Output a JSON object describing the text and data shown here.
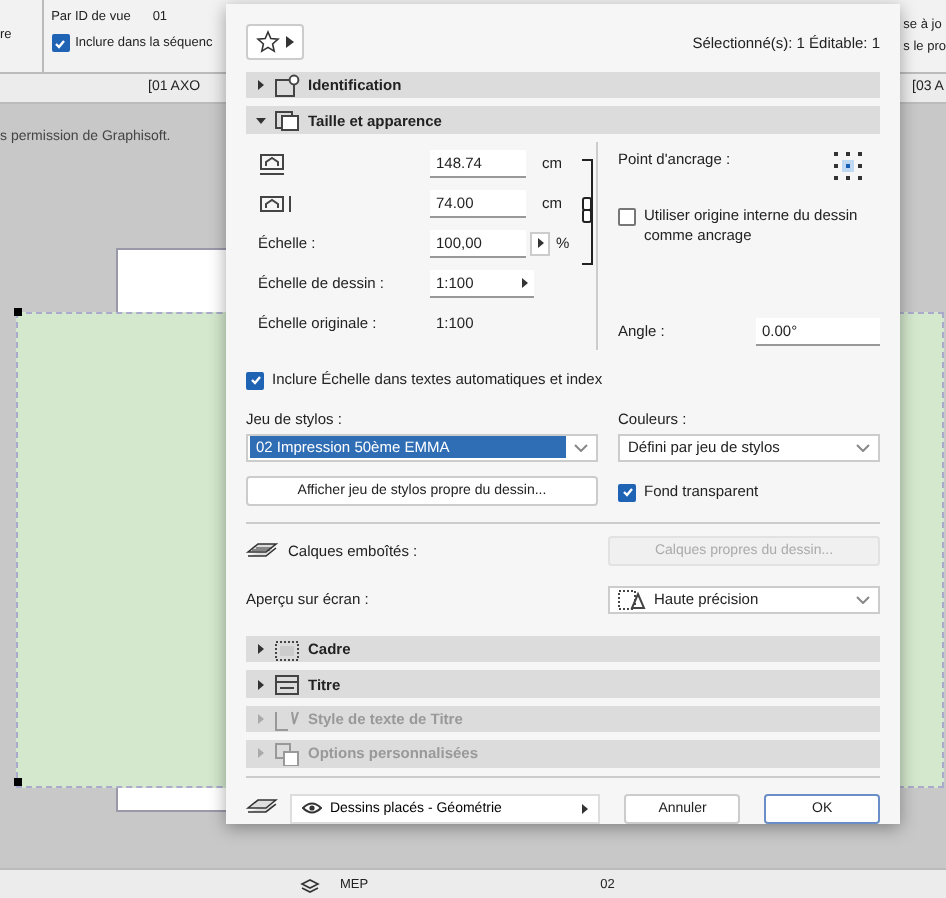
{
  "background": {
    "toolbar": {
      "view_menu": "re",
      "id_label": "Par ID de vue",
      "id_value": "01",
      "include": {
        "label": "Inclure dans la séquenc",
        "checked": true
      },
      "right_texts": [
        "se à jo",
        "s le pro"
      ]
    },
    "view_tabs": [
      "[01 AXO",
      "[03 A"
    ],
    "notice": "s permission de Graphisoft.",
    "bottom_bar": {
      "layer": "MEP",
      "pen": "02"
    }
  },
  "dialog": {
    "selection": "Sélectionné(s): 1 Éditable: 1",
    "sections": [
      {
        "title": "Identification",
        "expanded": false,
        "disabled": false
      },
      {
        "title": "Taille et apparence",
        "expanded": true,
        "disabled": false
      },
      {
        "title": "Cadre",
        "expanded": false,
        "disabled": false
      },
      {
        "title": "Titre",
        "expanded": false,
        "disabled": false
      },
      {
        "title": "Style de texte de Titre",
        "expanded": false,
        "disabled": true
      },
      {
        "title": "Options personnalisées",
        "expanded": false,
        "disabled": true
      }
    ],
    "size": {
      "width": {
        "value": "148.74",
        "unit": "cm"
      },
      "height": {
        "value": "74.00",
        "unit": "cm"
      },
      "scale": {
        "label": "Échelle :",
        "value": "100,00",
        "unit": "%"
      },
      "drawing_scale": {
        "label": "Échelle de dessin :",
        "value": "1:100"
      },
      "original_scale": {
        "label": "Échelle originale :",
        "value": "1:100"
      }
    },
    "anchor": {
      "label": "Point d'ancrage :",
      "use_origin": {
        "label": "Utiliser origine interne du dessin comme ancrage",
        "checked": false
      },
      "angle_label": "Angle :",
      "angle": "0.00°"
    },
    "include_scale": {
      "label": "Inclure Échelle dans textes automatiques et index",
      "checked": true
    },
    "pens": {
      "label": "Jeu de stylos :",
      "value": "02   Impression 50ème EMMA",
      "selected": true,
      "button": "Afficher jeu de stylos propre du dessin..."
    },
    "colors": {
      "label": "Couleurs :",
      "value": "Défini par jeu de stylos",
      "transparent": {
        "label": "Fond transparent",
        "checked": true
      }
    },
    "layers": {
      "label": "Calques emboîtés :",
      "button": "Calques propres du dessin...",
      "disabled": true
    },
    "preview": {
      "label": "Aperçu sur écran :",
      "value": "Haute précision"
    },
    "footer": {
      "layer_set": "Dessins placés - Géométrie",
      "cancel": "Annuler",
      "ok": "OK"
    }
  }
}
